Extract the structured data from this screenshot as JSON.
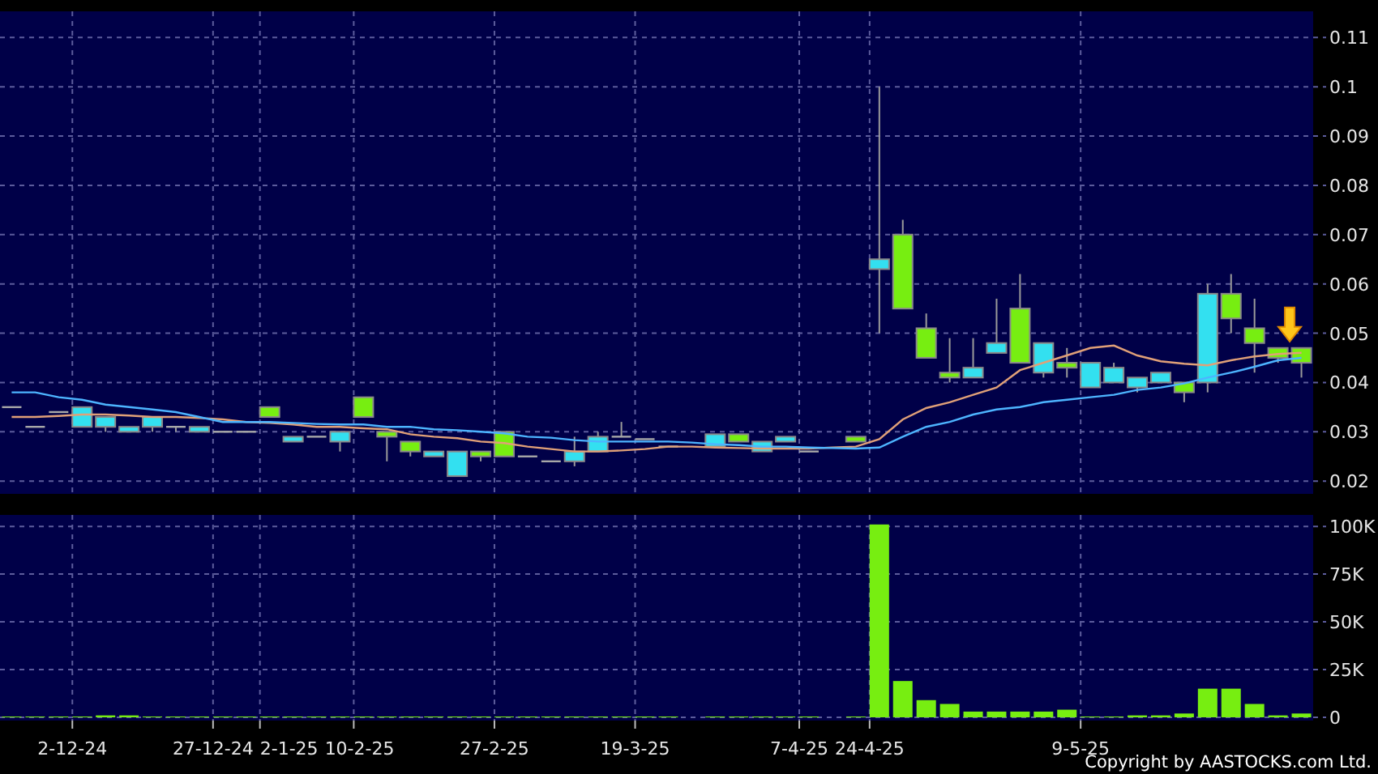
{
  "price_chart": {
    "chart_data": {
      "type": "candlestick",
      "categories": [
        null,
        null,
        null,
        null,
        null,
        null,
        null,
        null,
        null,
        null,
        null,
        null,
        null,
        null,
        null,
        null,
        null,
        null,
        null,
        null,
        null,
        null,
        null,
        null,
        null,
        null,
        null,
        null,
        null,
        null,
        null,
        null,
        null,
        null,
        null,
        null,
        null,
        null,
        null,
        null,
        null,
        null,
        null,
        null,
        null,
        null,
        null,
        null,
        null,
        null,
        null,
        null,
        null,
        null,
        null,
        null
      ],
      "ylim": [
        0.0174,
        0.1153
      ],
      "grid": true,
      "yticks": [
        0.02,
        0.03,
        0.04,
        0.05,
        0.06,
        0.07,
        0.08,
        0.09,
        0.1,
        0.11
      ],
      "series": [
        {
          "type": "line",
          "color": "#e0a078",
          "values": [
            0.033,
            0.033,
            0.0332,
            0.0335,
            0.0335,
            0.0333,
            0.033,
            0.033,
            0.0328,
            0.0325,
            0.032,
            0.0318,
            0.0315,
            0.031,
            0.031,
            0.0307,
            0.0305,
            0.0295,
            0.029,
            0.0287,
            0.028,
            0.0277,
            0.027,
            0.0265,
            0.026,
            0.026,
            0.0262,
            0.0265,
            0.027,
            0.027,
            0.0268,
            0.0267,
            0.0266,
            0.0266,
            0.0266,
            0.0268,
            0.027,
            0.0285,
            0.0325,
            0.0348,
            0.036,
            0.0375,
            0.039,
            0.0425,
            0.044,
            0.0455,
            0.047,
            0.0475,
            0.0455,
            0.0443,
            0.0438,
            0.0435,
            0.0445,
            0.0453,
            0.0458,
            0.046
          ]
        },
        {
          "type": "line",
          "color": "#4db4ff",
          "values": [
            0.038,
            0.038,
            0.037,
            0.0365,
            0.0355,
            0.035,
            0.0345,
            0.034,
            0.033,
            0.032,
            0.032,
            0.032,
            0.0318,
            0.0316,
            0.0315,
            0.0315,
            0.031,
            0.031,
            0.0305,
            0.0303,
            0.03,
            0.0297,
            0.029,
            0.0288,
            0.0283,
            0.028,
            0.028,
            0.028,
            0.028,
            0.0278,
            0.0275,
            0.0273,
            0.027,
            0.027,
            0.0268,
            0.0267,
            0.0266,
            0.0268,
            0.029,
            0.031,
            0.032,
            0.0335,
            0.0345,
            0.035,
            0.036,
            0.0365,
            0.037,
            0.0375,
            0.0385,
            0.039,
            0.0398,
            0.041,
            0.042,
            0.0432,
            0.0445,
            0.045
          ]
        }
      ],
      "ohlc": [
        [
          0.035,
          0.035,
          0.035,
          0.035
        ],
        [
          0.031,
          0.031,
          0.031,
          0.031
        ],
        [
          0.034,
          0.034,
          0.034,
          0.034
        ],
        [
          0.031,
          0.035,
          0.031,
          0.035
        ],
        [
          0.031,
          0.033,
          0.03,
          0.033
        ],
        [
          0.03,
          0.031,
          0.03,
          0.031
        ],
        [
          0.031,
          0.033,
          0.03,
          0.033
        ],
        [
          0.031,
          0.031,
          0.03,
          0.031
        ],
        [
          0.03,
          0.031,
          0.03,
          0.031
        ],
        [
          0.03,
          0.03,
          0.03,
          0.03
        ],
        [
          0.03,
          0.03,
          0.03,
          0.03
        ],
        [
          0.035,
          0.035,
          0.033,
          0.033
        ],
        [
          0.028,
          0.029,
          0.028,
          0.029
        ],
        [
          0.029,
          0.029,
          0.029,
          0.029
        ],
        [
          0.028,
          0.03,
          0.026,
          0.03
        ],
        [
          0.037,
          0.037,
          0.033,
          0.033
        ],
        [
          0.03,
          0.03,
          0.024,
          0.029
        ],
        [
          0.028,
          0.028,
          0.025,
          0.026
        ],
        [
          0.025,
          0.026,
          0.025,
          0.026
        ],
        [
          0.021,
          0.026,
          0.021,
          0.026
        ],
        [
          0.026,
          0.026,
          0.024,
          0.025
        ],
        [
          0.03,
          0.03,
          0.025,
          0.025
        ],
        [
          0.025,
          0.025,
          0.025,
          0.025
        ],
        [
          0.024,
          0.024,
          0.024,
          0.024
        ],
        [
          0.024,
          0.029,
          0.023,
          0.026
        ],
        [
          0.026,
          0.03,
          0.026,
          0.029
        ],
        [
          0.029,
          0.032,
          0.029,
          0.029
        ],
        [
          0.0285,
          0.0285,
          0.0285,
          0.0285
        ],
        [
          0.027,
          0.027,
          0.027,
          0.027
        ],
        null,
        [
          0.027,
          0.0295,
          0.027,
          0.0295
        ],
        [
          0.0295,
          0.0295,
          0.028,
          0.028
        ],
        [
          0.026,
          0.028,
          0.026,
          0.028
        ],
        [
          0.028,
          0.029,
          0.028,
          0.029
        ],
        [
          0.026,
          0.026,
          0.026,
          0.026
        ],
        null,
        [
          0.029,
          0.029,
          0.028,
          0.028
        ],
        [
          0.063,
          0.1,
          0.05,
          0.065
        ],
        [
          0.07,
          0.073,
          0.055,
          0.055
        ],
        [
          0.051,
          0.054,
          0.045,
          0.045
        ],
        [
          0.042,
          0.049,
          0.04,
          0.041
        ],
        [
          0.041,
          0.049,
          0.041,
          0.043
        ],
        [
          0.046,
          0.057,
          0.046,
          0.048
        ],
        [
          0.055,
          0.062,
          0.044,
          0.044
        ],
        [
          0.042,
          0.048,
          0.041,
          0.048
        ],
        [
          0.044,
          0.047,
          0.041,
          0.043
        ],
        [
          0.039,
          0.044,
          0.039,
          0.044
        ],
        [
          0.04,
          0.044,
          0.04,
          0.043
        ],
        [
          0.039,
          0.041,
          0.038,
          0.041
        ],
        [
          0.04,
          0.042,
          0.04,
          0.042
        ],
        [
          0.04,
          0.04,
          0.036,
          0.038
        ],
        [
          0.04,
          0.06,
          0.038,
          0.058
        ],
        [
          0.058,
          0.062,
          0.05,
          0.053
        ],
        [
          0.051,
          0.057,
          0.042,
          0.048
        ],
        [
          0.047,
          0.047,
          0.044,
          0.045
        ],
        [
          0.047,
          0.047,
          0.041,
          0.044
        ]
      ]
    }
  },
  "volume_chart": {
    "chart_data": {
      "type": "bar",
      "grid": true,
      "categories": [
        null,
        null,
        null,
        "2-12-24",
        null,
        null,
        null,
        null,
        null,
        "27-12-24",
        null,
        "2-1-25",
        null,
        null,
        null,
        "10-2-25",
        null,
        null,
        null,
        null,
        null,
        "27-2-25",
        null,
        null,
        null,
        null,
        null,
        "19-3-25",
        null,
        null,
        null,
        null,
        null,
        null,
        "7-4-25",
        null,
        null,
        "24-4-25",
        null,
        null,
        null,
        null,
        null,
        null,
        null,
        null,
        "9-5-25",
        null,
        null,
        null,
        null,
        null,
        null,
        null,
        null,
        null
      ],
      "ylim": [
        -1700,
        106000
      ],
      "yticks": [
        {
          "value": 0,
          "label": "0"
        },
        {
          "value": 25000,
          "label": "25K"
        },
        {
          "value": 50000,
          "label": "50K"
        },
        {
          "value": 75000,
          "label": "75K"
        },
        {
          "value": 100000,
          "label": "100K"
        }
      ],
      "series": [
        {
          "color": "#77ee11",
          "values": [
            0,
            0,
            0,
            0,
            1000,
            1000,
            0,
            0,
            0,
            0,
            0,
            0,
            0,
            0,
            0,
            0,
            0,
            0,
            0,
            0,
            0,
            0,
            0,
            0,
            0,
            0,
            0,
            0,
            0,
            null,
            0,
            0,
            0,
            0,
            0,
            null,
            0,
            101000,
            19000,
            9000,
            7000,
            3000,
            3000,
            3000,
            3000,
            4000,
            0,
            0,
            1000,
            1000,
            2000,
            15000,
            15000,
            7000,
            1000,
            2000
          ]
        }
      ]
    }
  },
  "copyright": "Copyright by AASTOCKS.com Ltd."
}
